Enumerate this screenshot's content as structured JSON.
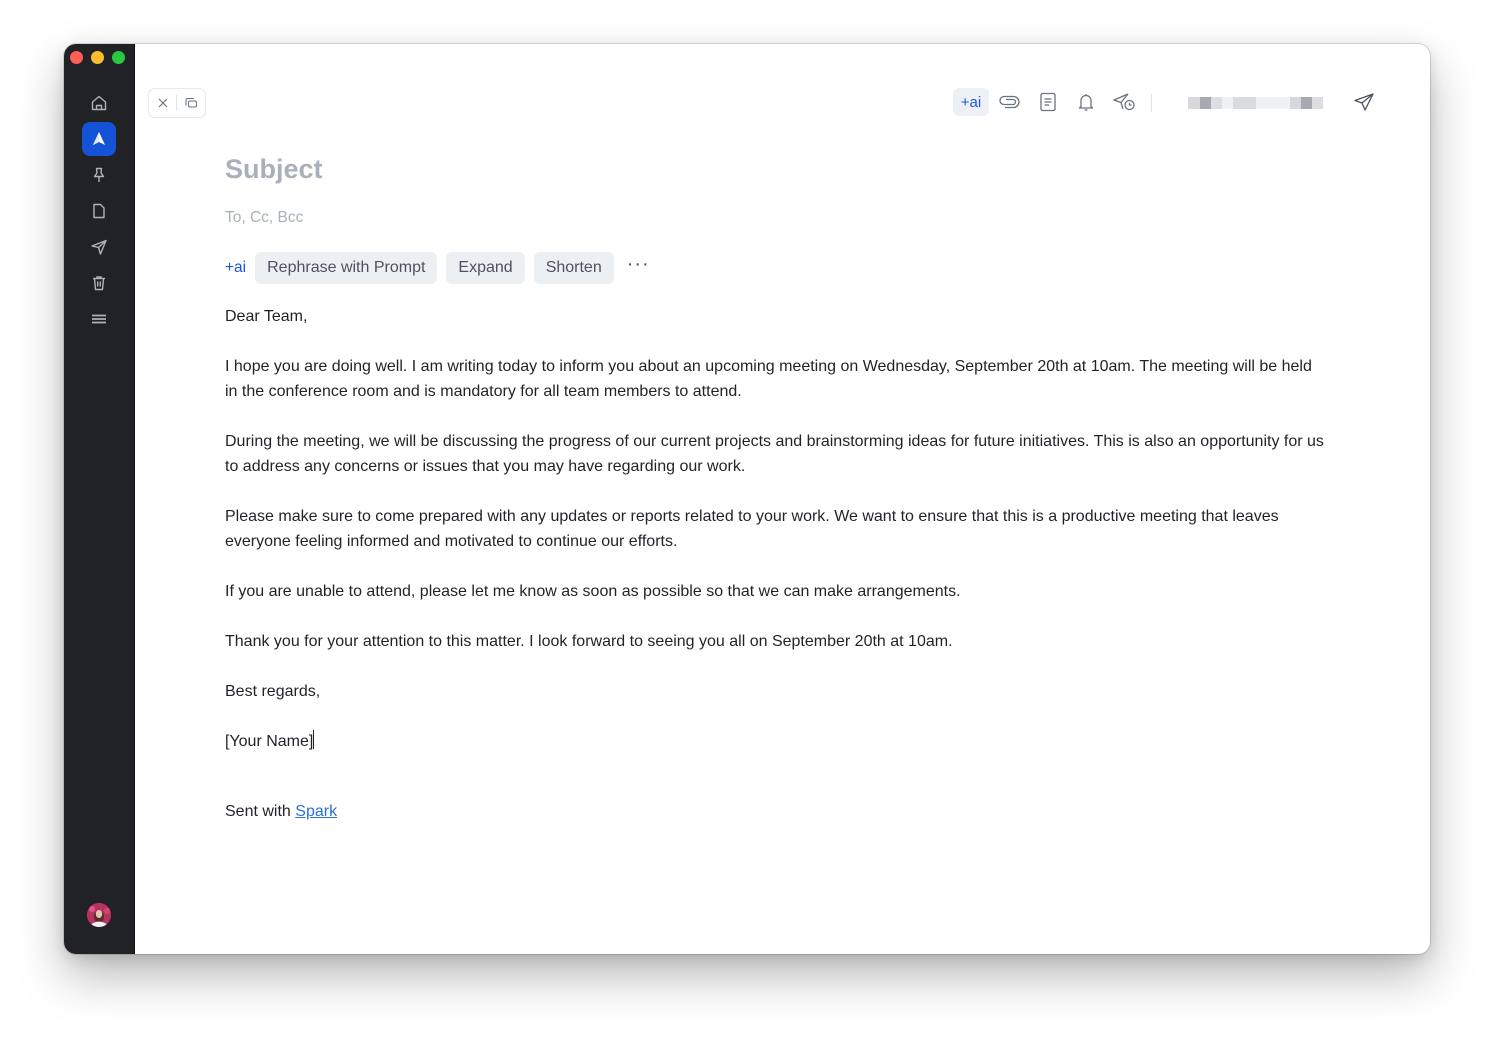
{
  "window": {
    "traffic_lights": [
      "close",
      "minimize",
      "maximize"
    ]
  },
  "sidebar": {
    "items": [
      {
        "name": "home",
        "icon": "home-icon",
        "active": false
      },
      {
        "name": "spark-compose",
        "icon": "spark-logo-icon",
        "active": true
      },
      {
        "name": "pinned",
        "icon": "pin-icon",
        "active": false
      },
      {
        "name": "drafts",
        "icon": "document-icon",
        "active": false
      },
      {
        "name": "sent",
        "icon": "send-icon",
        "active": false
      },
      {
        "name": "trash",
        "icon": "trash-icon",
        "active": false
      },
      {
        "name": "menu",
        "icon": "menu-icon",
        "active": false
      }
    ],
    "avatar": "user-avatar"
  },
  "composer": {
    "window_buttons": [
      {
        "name": "close",
        "icon": "close-icon"
      },
      {
        "name": "pop-out",
        "icon": "pop-out-icon"
      }
    ],
    "toolbar": {
      "ai_label": "+ai",
      "icons": [
        "attachment-icon",
        "template-icon",
        "reminder-bell-icon",
        "send-later-icon"
      ],
      "from_address": "[redacted]",
      "send_icon": "send-icon"
    },
    "subject_placeholder": "Subject",
    "recipients_placeholder": "To, Cc, Bcc",
    "ai_bar": {
      "label": "+ai",
      "actions": [
        "Rephrase with Prompt",
        "Expand",
        "Shorten"
      ],
      "more": "···"
    },
    "body": {
      "greeting": "Dear Team,",
      "paragraphs": [
        "I hope you are doing well. I am writing today to inform you about an upcoming meeting on Wednesday, September 20th at 10am. The meeting will be held in the conference room and is mandatory for all team members to attend.",
        "During the meeting, we will be discussing the progress of our current projects and brainstorming ideas for future initiatives. This is also an opportunity for us to address any concerns or issues that you may have regarding our work.",
        "Please make sure to come prepared with any updates or reports related to your work. We want to ensure that this is a productive meeting that leaves everyone feeling informed and motivated to continue our efforts.",
        "If you are unable to attend, please let me know as soon as possible so that we can make arrangements.",
        "Thank you for your attention to this matter. I look forward to seeing you all on September 20th at 10am."
      ],
      "closing": "Best regards,",
      "name": "[Your Name]"
    },
    "signature": {
      "prefix": "Sent with ",
      "link_text": "Spark"
    }
  },
  "colors": {
    "accent": "#1453d6",
    "ai_blue": "#1a56db",
    "sidebar_bg": "#202226",
    "placeholder": "#a9b0bb",
    "link": "#2a6fdb"
  }
}
